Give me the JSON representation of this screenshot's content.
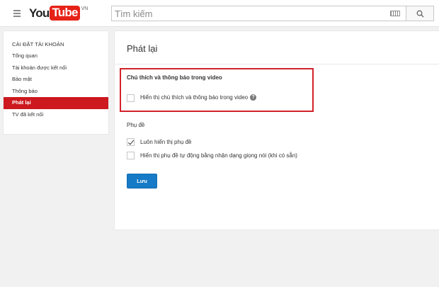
{
  "header": {
    "logo_you": "You",
    "logo_tube": "Tube",
    "logo_region": "VN",
    "search_placeholder": "Tìm kiếm"
  },
  "sidebar": {
    "heading": "CÀI ĐẶT TÀI KHOẢN",
    "items": [
      {
        "label": "Tổng quan",
        "active": false
      },
      {
        "label": "Tài khoản được kết nối",
        "active": false
      },
      {
        "label": "Bảo mật",
        "active": false
      },
      {
        "label": "Thông báo",
        "active": false
      },
      {
        "label": "Phát lại",
        "active": true
      },
      {
        "label": "TV đã kết nối",
        "active": false
      }
    ]
  },
  "main": {
    "title": "Phát lại",
    "annotations": {
      "heading": "Chú thích và thông báo trong video",
      "option_label": "Hiển thị chú thích và thông báo trong video",
      "option_checked": false,
      "help_icon": "?"
    },
    "subtitles": {
      "heading": "Phụ đề",
      "options": [
        {
          "label": "Luôn hiển thị phụ đề",
          "checked": true
        },
        {
          "label": "Hiển thị phụ đề tự động bằng nhận dạng giọng nói (khi có sẵn)",
          "checked": false
        }
      ]
    },
    "save_label": "Lưu"
  },
  "colors": {
    "accent_red": "#cc181e",
    "highlight_border": "#d3222a",
    "button_blue": "#167ac6"
  }
}
